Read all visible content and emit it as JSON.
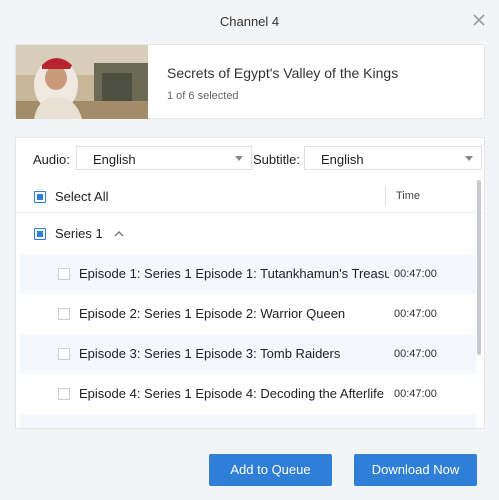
{
  "window": {
    "title": "Channel 4"
  },
  "show": {
    "title": "Secrets of Egypt's Valley of the Kings",
    "selected_count": "1 of 6 selected"
  },
  "options": {
    "audio_label": "Audio:",
    "audio_value": "English",
    "subtitle_label": "Subtitle:",
    "subtitle_value": "English"
  },
  "list": {
    "select_all_label": "Select All",
    "time_header": "Time",
    "series_label": "Series 1",
    "episodes": [
      {
        "title": "Episode 1: Series 1 Episode 1: Tutankhamun's Treasu",
        "time": "00:47:00",
        "checked": false
      },
      {
        "title": "Episode 2: Series 1 Episode 2: Warrior Queen",
        "time": "00:47:00",
        "checked": false
      },
      {
        "title": "Episode 3: Series 1 Episode 3: Tomb Raiders",
        "time": "00:47:00",
        "checked": false
      },
      {
        "title": "Episode 4: Series 1 Episode 4: Decoding the Afterlife",
        "time": "00:47:00",
        "checked": false
      }
    ]
  },
  "buttons": {
    "add_to_queue": "Add to Queue",
    "download_now": "Download Now"
  },
  "colors": {
    "accent": "#2f7ed8",
    "row_alt": "#f4f7fb"
  }
}
